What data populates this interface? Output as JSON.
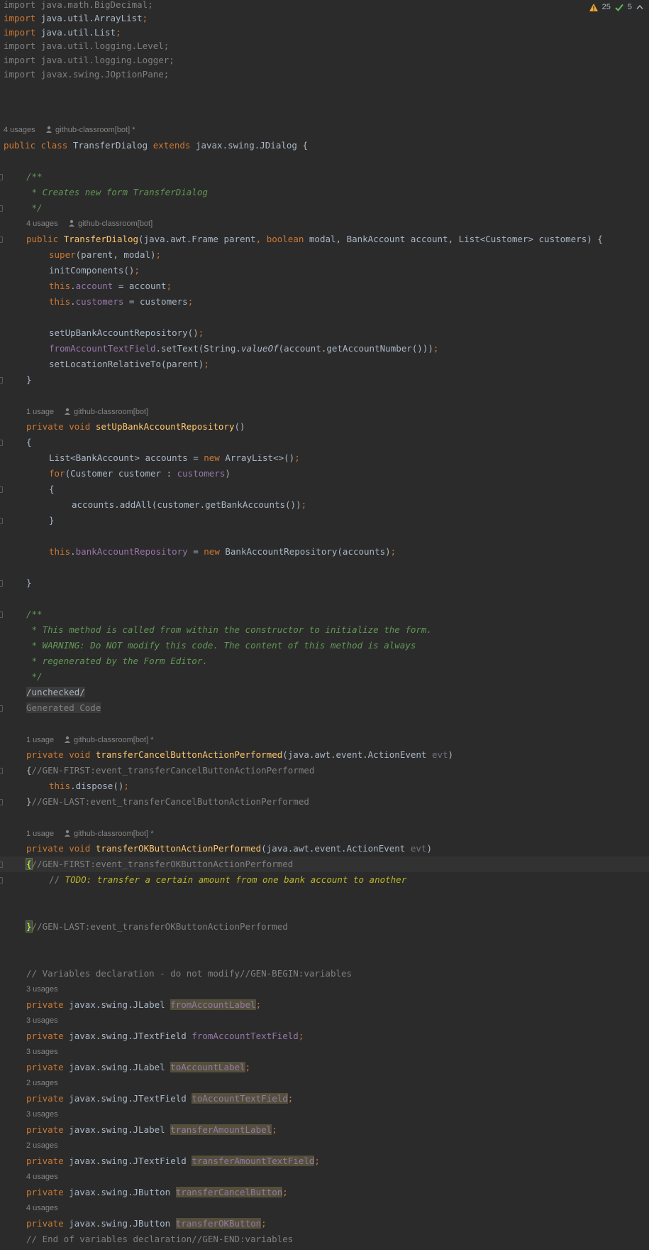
{
  "inspection": {
    "warnings": "25",
    "ok": "5"
  },
  "hints": {
    "h1_usages": "4 usages",
    "h1_author": "github-classroom[bot] *",
    "h2_usages": "4 usages",
    "h2_author": "github-classroom[bot]",
    "h3_usages": "1 usage",
    "h3_author": "github-classroom[bot]",
    "h4_usages": "1 usage",
    "h4_author": "github-classroom[bot] *",
    "h5_usages": "1 usage",
    "h5_author": "github-classroom[bot] *",
    "v1": "3 usages",
    "v2": "3 usages",
    "v3": "3 usages",
    "v4": "2 usages",
    "v5": "3 usages",
    "v6": "2 usages",
    "v7": "4 usages",
    "v8": "4 usages"
  },
  "code": {
    "l1_a": "import",
    "l1_b": " java.math.BigDecimal;",
    "l2_a": "import",
    "l2_b": " java.util.ArrayList",
    "l2_c": ";",
    "l3_a": "import",
    "l3_b": " java.util.List",
    "l3_c": ";",
    "l4": "import java.util.logging.Level;",
    "l5": "import java.util.logging.Logger;",
    "l6": "import javax.swing.JOptionPane;",
    "class_a": "public class",
    "class_b": " TransferDialog ",
    "class_c": "extends",
    "class_d": " javax.swing.JDialog {",
    "doc1": "/**",
    "doc2": " * Creates new form TransferDialog",
    "doc3": " */",
    "ctor_a": "public",
    "ctor_b": "TransferDialog",
    "ctor_c": "(java.awt.Frame parent",
    "ctor_d": ", ",
    "ctor_e": "boolean",
    "ctor_f": " modal",
    "ctor_g": ", BankAccount account",
    "ctor_h": ", List<Customer> customers) {",
    "super_a": "super",
    "super_b": "(parent",
    "super_c": ", modal)",
    "super_d": ";",
    "init_a": "initComponents()",
    "init_b": ";",
    "this1_a": "this",
    "this1_b": ".",
    "this1_c": "account",
    "this1_d": " = account",
    "this1_e": ";",
    "this2_a": "this",
    "this2_b": ".",
    "this2_c": "customers",
    "this2_d": " = customers",
    "this2_e": ";",
    "setup_a": "setUpBankAccountRepository()",
    "setup_b": ";",
    "from_a": "fromAccountTextField",
    "from_b": ".setText(String.",
    "from_c": "valueOf",
    "from_d": "(account.getAccountNumber()))",
    "from_e": ";",
    "loc_a": "setLocationRelativeTo(parent)",
    "loc_b": ";",
    "close1": "}",
    "m1_a": "private void ",
    "m1_b": "setUpBankAccountRepository",
    "m1_c": "()",
    "open1": "{",
    "list_a": "List<BankAccount> accounts = ",
    "list_b": "new",
    "list_c": " ArrayList<>()",
    "list_d": ";",
    "for_a": "for",
    "for_b": "(Customer customer : ",
    "for_c": "customers",
    "for_d": ")",
    "open2": "{",
    "add_a": "accounts.addAll(customer.getBankAccounts())",
    "add_b": ";",
    "close2": "}",
    "repo_a": "this",
    "repo_b": ".",
    "repo_c": "bankAccountRepository",
    "repo_d": " = ",
    "repo_e": "new",
    "repo_f": " BankAccountRepository(accounts)",
    "repo_g": ";",
    "close3": "}",
    "doc4": "/**",
    "doc5": " * This method is called from within the constructor to initialize the form.",
    "doc6": " * WARNING: Do NOT modify this code. The content of this method is always",
    "doc7": " * regenerated by the Form Editor.",
    "doc8": " */",
    "unchecked": "/unchecked/",
    "generated": "Generated Code",
    "m2_a": "private void ",
    "m2_b": "transferCancelButtonActionPerformed",
    "m2_c": "(java.awt.event.ActionEvent ",
    "m2_d": "evt",
    "m2_e": ")",
    "gf1_a": "{",
    "gf1_b": "//GEN-FIRST:event_transferCancelButtonActionPerformed",
    "disp_a": "this",
    "disp_b": ".dispose()",
    "disp_c": ";",
    "gl1_a": "}",
    "gl1_b": "//GEN-LAST:event_transferCancelButtonActionPerformed",
    "m3_a": "private void ",
    "m3_b": "transferOKButtonActionPerformed",
    "m3_c": "(java.awt.event.ActionEvent ",
    "m3_d": "evt",
    "m3_e": ")",
    "gf2_a": "{",
    "gf2_b": "//GEN-FIRST:event_transferOKButtonActionPerformed",
    "todo_a": "// ",
    "todo_b": "TODO: transfer a certain amount from one bank account to another",
    "gl2_a": "}",
    "gl2_b": "//GEN-LAST:event_transferOKButtonActionPerformed",
    "vars_begin": "// Variables declaration - do not modify//GEN-BEGIN:variables",
    "v1_a": "private",
    "v1_b": " javax.swing.JLabel ",
    "v1_c": "fromAccountLabel",
    "v1_d": ";",
    "v2_a": "private",
    "v2_b": " javax.swing.JTextField ",
    "v2_c": "fromAccountTextField",
    "v2_d": ";",
    "v3_a": "private",
    "v3_b": " javax.swing.JLabel ",
    "v3_c": "toAccountLabel",
    "v3_d": ";",
    "v4_a": "private",
    "v4_b": " javax.swing.JTextField ",
    "v4_c": "toAccountTextField",
    "v4_d": ";",
    "v5_a": "private",
    "v5_b": " javax.swing.JLabel ",
    "v5_c": "transferAmountLabel",
    "v5_d": ";",
    "v6_a": "private",
    "v6_b": " javax.swing.JTextField ",
    "v6_c": "transferAmountTextField",
    "v6_d": ";",
    "v7_a": "private",
    "v7_b": " javax.swing.JButton ",
    "v7_c": "transferCancelButton",
    "v7_d": ";",
    "v8_a": "private",
    "v8_b": " javax.swing.JButton ",
    "v8_c": "transferOKButton",
    "v8_d": ";",
    "vars_end": "// End of variables declaration//GEN-END:variables"
  }
}
